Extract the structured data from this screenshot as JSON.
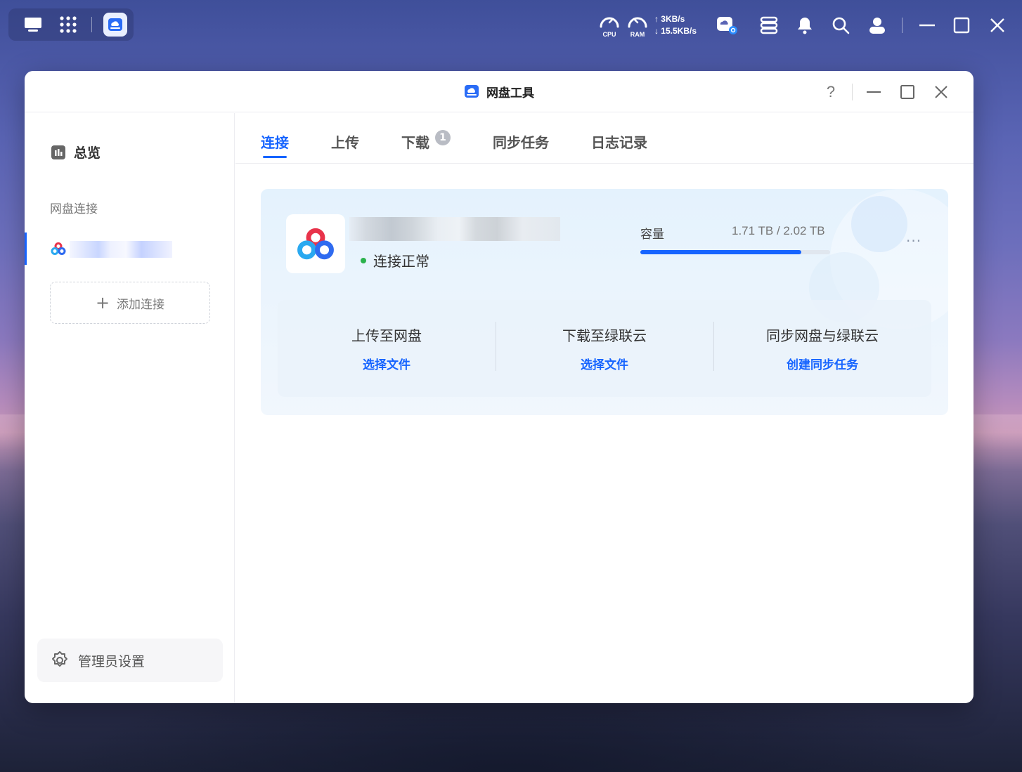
{
  "desktop": {
    "active_app_icon": "cloud-drive-icon",
    "system": {
      "cpu_label": "CPU",
      "ram_label": "RAM",
      "upload_speed": "↑ 3KB/s",
      "download_speed": "↓ 15.5KB/s"
    }
  },
  "window": {
    "title": "网盘工具",
    "help": "?"
  },
  "sidebar": {
    "overview_label": "总览",
    "section_label": "网盘连接",
    "add_connection_label": "添加连接",
    "admin_label": "管理员设置"
  },
  "tabs": [
    {
      "label": "连接",
      "active": true
    },
    {
      "label": "上传"
    },
    {
      "label": "下载",
      "badge": "1"
    },
    {
      "label": "同步任务"
    },
    {
      "label": "日志记录"
    }
  ],
  "connection": {
    "status": "连接正常",
    "capacity_label": "容量",
    "capacity_value": "1.71 TB / 2.02 TB",
    "capacity_used_fraction": 0.847,
    "more": "···"
  },
  "actions": [
    {
      "title": "上传至网盘",
      "link": "选择文件"
    },
    {
      "title": "下载至绿联云",
      "link": "选择文件"
    },
    {
      "title": "同步网盘与绿联云",
      "link": "创建同步任务"
    }
  ],
  "colors": {
    "accent": "#1664ff",
    "status_ok": "#2bb24c"
  }
}
